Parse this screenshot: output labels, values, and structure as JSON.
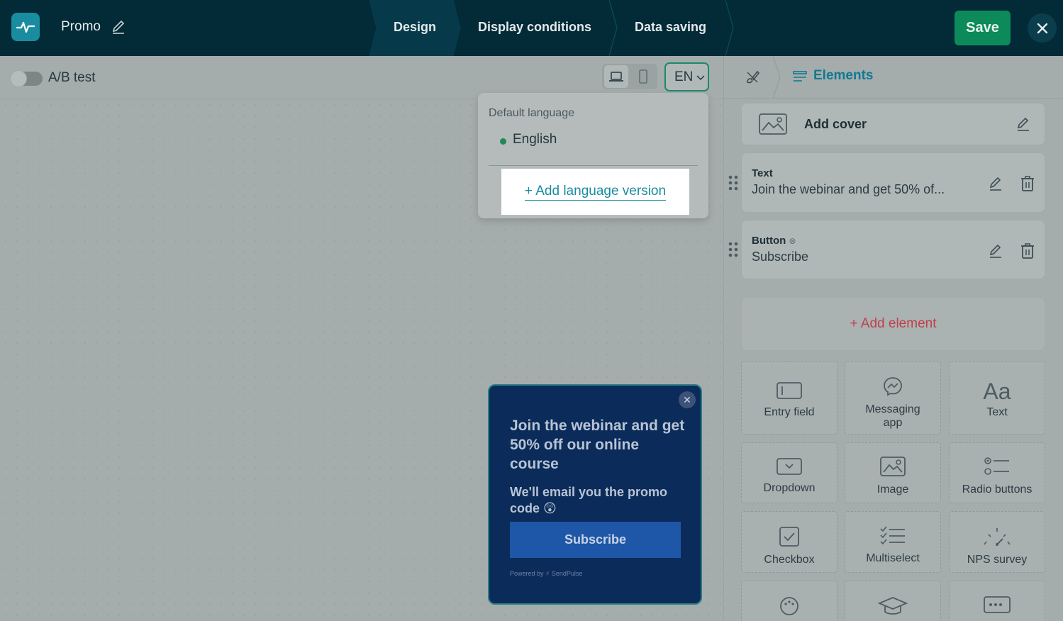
{
  "header": {
    "title": "Promo",
    "steps": [
      "Design",
      "Display conditions",
      "Data saving"
    ],
    "save_label": "Save"
  },
  "toolbar": {
    "ab_test_label": "A/B test",
    "language_code": "EN"
  },
  "language_dropdown": {
    "section_label": "Default language",
    "default_language": "English",
    "add_label": "+ Add language version"
  },
  "popup": {
    "title": "Join the webinar and get 50% off our online course",
    "subtitle": "We'll email you the promo code 😲",
    "button_label": "Subscribe",
    "powered_by": "Powered by ⚡ SendPulse"
  },
  "right_panel": {
    "tab_label": "Elements",
    "cover_label": "Add cover",
    "elements": [
      {
        "type": "Text",
        "value": "Join the webinar and get 50% of..."
      },
      {
        "type": "Button",
        "value": "Subscribe"
      }
    ],
    "add_element_label": "+ Add element",
    "palette": [
      "Entry field",
      "Messaging app",
      "Text",
      "Dropdown",
      "Image",
      "Radio buttons",
      "Checkbox",
      "Multiselect",
      "NPS survey"
    ]
  },
  "colors": {
    "topbar": "#022a37",
    "save": "#0d8a5a",
    "accent": "#1a8ca0",
    "popup_bg": "#0b2b5a",
    "add_element": "#c0404a"
  },
  "icons": {
    "logo": "pulse-logo-icon",
    "edit": "pencil-icon",
    "close": "close-icon",
    "laptop": "laptop-icon",
    "phone": "phone-icon",
    "chevron": "chevron-down-icon",
    "trash": "trash-icon",
    "drag": "drag-handle-icon",
    "image": "image-icon",
    "brush": "paint-brush-icon",
    "list": "list-icon"
  }
}
